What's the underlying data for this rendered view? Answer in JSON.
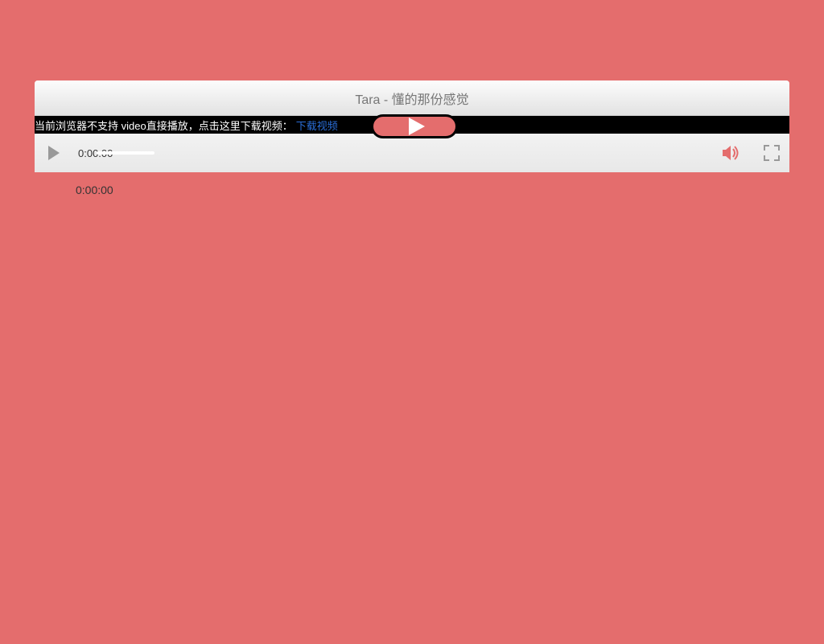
{
  "player": {
    "title": "Tara - 懂的那份感觉",
    "unsupported_message": "当前浏览器不支持 video直接播放，点击这里下载视频：",
    "download_link_text": "下载视频",
    "current_time": "0:00:00",
    "below_time": "0:00:00"
  },
  "colors": {
    "background": "#e46d6d",
    "accent": "#e46d6d"
  }
}
